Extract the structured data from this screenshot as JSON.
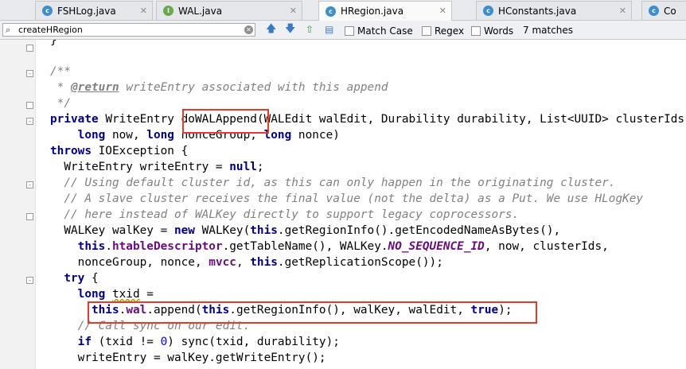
{
  "tabs": [
    {
      "label": "FSHLog.java",
      "icon": "class-icon",
      "active": false
    },
    {
      "label": "WAL.java",
      "icon": "interface-icon",
      "active": false
    },
    {
      "label": "HRegion.java",
      "icon": "class-icon",
      "active": true
    },
    {
      "label": "HConstants.java",
      "icon": "class-icon",
      "active": false
    },
    {
      "label": "Co",
      "icon": "class-icon",
      "active": false
    }
  ],
  "search": {
    "value": "createHRegion",
    "match_case_label": "Match Case",
    "regex_label": "Regex",
    "words_label": "Words",
    "match_count": "7 matches"
  },
  "code_lines": [
    "}",
    "",
    "/**",
    " * @return writeEntry associated with this append",
    " */",
    "private WriteEntry doWALAppend(WALEdit walEdit, Durability durability, List<UUID> clusterIds,",
    "    long now, long nonceGroup, long nonce)",
    "throws IOException {",
    "  WriteEntry writeEntry = null;",
    "  // Using default cluster id, as this can only happen in the originating cluster.",
    "  // A slave cluster receives the final value (not the delta) as a Put. We use HLogKey",
    "  // here instead of WALKey directly to support legacy coprocessors.",
    "  WALKey walKey = new WALKey(this.getRegionInfo().getEncodedNameAsBytes(),",
    "    this.htableDescriptor.getTableName(), WALKey.NO_SEQUENCE_ID, now, clusterIds,",
    "    nonceGroup, nonce, mvcc, this.getReplicationScope());",
    "  try {",
    "    long txid =",
    "      this.wal.append(this.getRegionInfo(), walKey, walEdit, true);",
    "    // Call sync on our edit.",
    "    if (txid != 0) sync(txid, durability);",
    "    writeEntry = walKey.getWriteEntry();"
  ],
  "highlights": [
    "doWALAppend",
    "this.wal.append(this.getRegionInfo(), walKey, walEdit, true);"
  ],
  "colors": {
    "keyword": "#000080",
    "comment": "#808080",
    "field": "#660e7a",
    "number": "#0000ff",
    "highlight_box": "#e8392d"
  }
}
